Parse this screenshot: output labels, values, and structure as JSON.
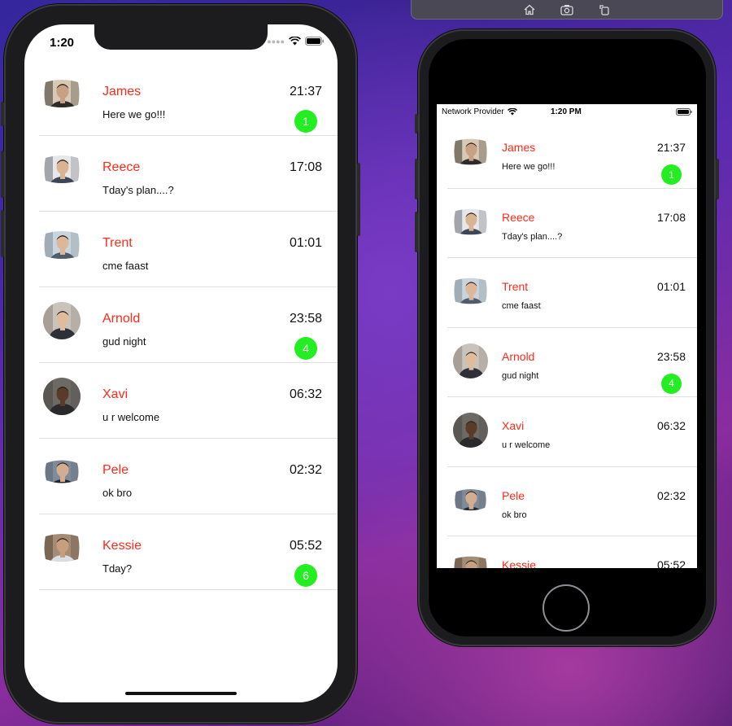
{
  "colors": {
    "name": "#ff2a1a",
    "badge": "#22ee22",
    "divider": "#e0e0e0"
  },
  "toolbar": {
    "icons": [
      "home-icon",
      "screenshot-icon",
      "rotate-icon"
    ]
  },
  "phone_large": {
    "status": {
      "time": "1:20",
      "icons": [
        "signal-dots-icon",
        "wifi-icon",
        "battery-icon"
      ]
    }
  },
  "phone_small": {
    "status": {
      "carrier": "Network Provider",
      "time": "1:20 PM",
      "icons": [
        "wifi-icon",
        "battery-icon"
      ]
    }
  },
  "chats": [
    {
      "name": "James",
      "message": "Here we go!!!",
      "time": "21:37",
      "badge": "1",
      "avatar": "avatar-james"
    },
    {
      "name": "Reece",
      "message": "Tday's plan....?",
      "time": "17:08",
      "badge": "",
      "avatar": "avatar-reece"
    },
    {
      "name": "Trent",
      "message": "cme faast",
      "time": "01:01",
      "badge": "",
      "avatar": "avatar-trent"
    },
    {
      "name": "Arnold",
      "message": "gud night",
      "time": "23:58",
      "badge": "4",
      "avatar": "avatar-arnold"
    },
    {
      "name": "Xavi",
      "message": "u r welcome",
      "time": "06:32",
      "badge": "",
      "avatar": "avatar-xavi"
    },
    {
      "name": "Pele",
      "message": "ok bro",
      "time": "02:32",
      "badge": "",
      "avatar": "avatar-pele"
    },
    {
      "name": "Kessie",
      "message": "Tday?",
      "time": "05:52",
      "badge": "6",
      "avatar": "avatar-kessie"
    }
  ]
}
